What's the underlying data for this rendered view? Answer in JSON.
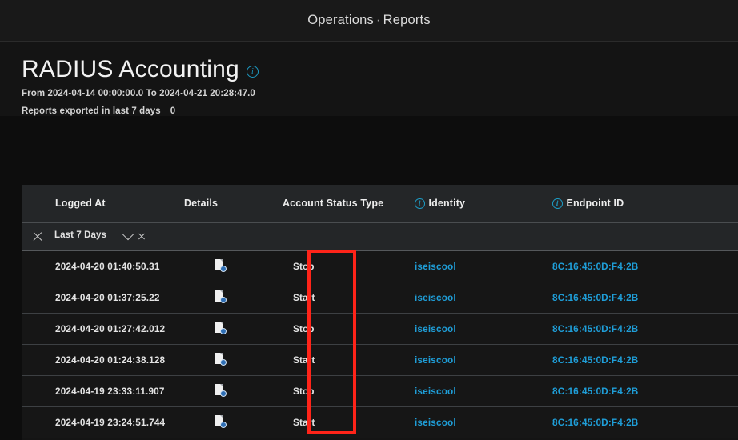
{
  "topbar": {
    "breadcrumb_parent": "Operations",
    "breadcrumb_separator": "·",
    "breadcrumb_current": "Reports"
  },
  "page": {
    "title": "RADIUS Accounting",
    "title_info_icon": "info-icon",
    "date_range": "From 2024-04-14 00:00:00.0 To 2024-04-21 20:28:47.0",
    "exported_label": "Reports exported in last 7 days",
    "exported_count": "0"
  },
  "table": {
    "columns": [
      {
        "key": "logged_at",
        "label": "Logged At",
        "has_info_icon": false
      },
      {
        "key": "details",
        "label": "Details",
        "has_info_icon": false
      },
      {
        "key": "status_type",
        "label": "Account Status Type",
        "has_info_icon": false
      },
      {
        "key": "identity",
        "label": "Identity",
        "has_info_icon": true
      },
      {
        "key": "endpoint_id",
        "label": "Endpoint ID",
        "has_info_icon": true
      }
    ],
    "filters": {
      "clear_all_icon": "close-icon",
      "logged_at_value": "Last 7 Days",
      "logged_at_dropdown_icon": "chevron-down-icon",
      "logged_at_clear_icon": "close-icon",
      "status_placeholder": "",
      "identity_placeholder": "",
      "endpoint_placeholder": ""
    },
    "rows": [
      {
        "logged_at": "2024-04-20 01:40:50.31",
        "details_icon": "details-report-icon",
        "status_type": "Stop",
        "identity": "iseiscool",
        "endpoint_id": "8C:16:45:0D:F4:2B"
      },
      {
        "logged_at": "2024-04-20 01:37:25.22",
        "details_icon": "details-report-icon",
        "status_type": "Start",
        "identity": "iseiscool",
        "endpoint_id": "8C:16:45:0D:F4:2B"
      },
      {
        "logged_at": "2024-04-20 01:27:42.012",
        "details_icon": "details-report-icon",
        "status_type": "Stop",
        "identity": "iseiscool",
        "endpoint_id": "8C:16:45:0D:F4:2B"
      },
      {
        "logged_at": "2024-04-20 01:24:38.128",
        "details_icon": "details-report-icon",
        "status_type": "Start",
        "identity": "iseiscool",
        "endpoint_id": "8C:16:45:0D:F4:2B"
      },
      {
        "logged_at": "2024-04-19 23:33:11.907",
        "details_icon": "details-report-icon",
        "status_type": "Stop",
        "identity": "iseiscool",
        "endpoint_id": "8C:16:45:0D:F4:2B"
      },
      {
        "logged_at": "2024-04-19 23:24:51.744",
        "details_icon": "details-report-icon",
        "status_type": "Start",
        "identity": "iseiscool",
        "endpoint_id": "8C:16:45:0D:F4:2B"
      }
    ]
  },
  "annotation": {
    "highlight_color": "#ff2419",
    "highlight_target": "account-status-type-column"
  },
  "colors": {
    "background": "#0d0d0d",
    "panel": "#141414",
    "header_row": "#242628",
    "link": "#1f9ed8",
    "accent_info": "#1d9bc4"
  }
}
